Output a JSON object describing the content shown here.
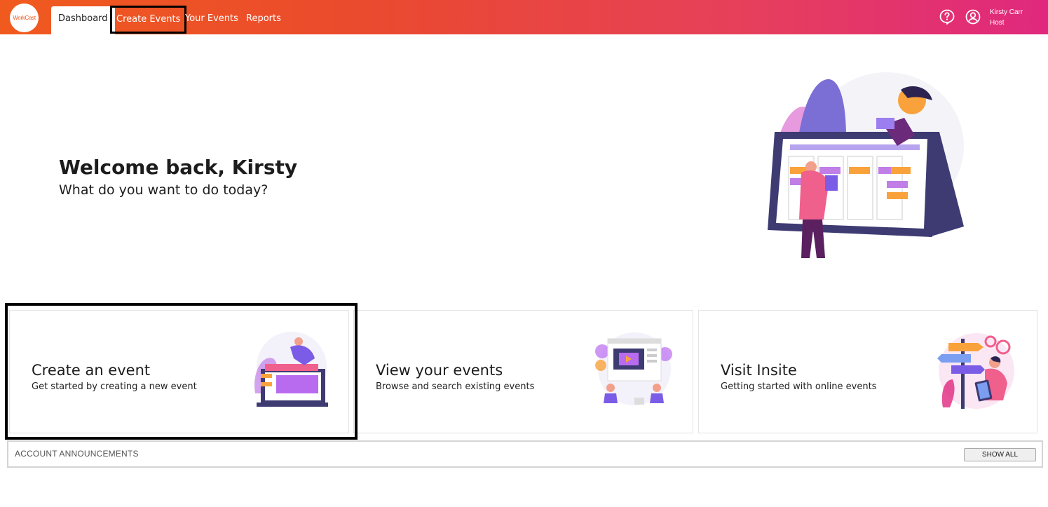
{
  "header": {
    "logo_text": "WorkCast",
    "tabs": [
      {
        "label": "Dashboard"
      },
      {
        "label": "Create Events"
      },
      {
        "label": "Your Events"
      },
      {
        "label": "Reports"
      }
    ],
    "user": {
      "name": "Kirsty Carr",
      "role": "Host"
    },
    "icons": [
      "help-icon",
      "user-account-icon"
    ]
  },
  "hero": {
    "title": "Welcome back, Kirsty",
    "subtitle": "What do you want to do today?"
  },
  "cards": [
    {
      "title": "Create an event",
      "description": "Get started by creating a new event"
    },
    {
      "title": "View your events",
      "description": "Browse and search existing events"
    },
    {
      "title": "Visit Insite",
      "description": "Getting started with online events"
    }
  ],
  "announcements": {
    "label": "ACCOUNT ANNOUNCEMENTS",
    "button": "SHOW ALL"
  },
  "colors": {
    "brand_orange": "#f05a1e",
    "brand_pink": "#e0287e",
    "illustration_purple": "#7b5ce6",
    "illustration_orange": "#f9a23b"
  }
}
